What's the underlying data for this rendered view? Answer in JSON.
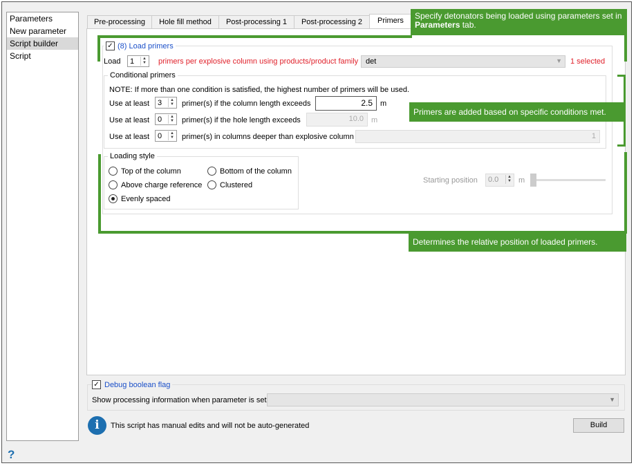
{
  "sidebar": {
    "items": [
      "Parameters",
      "New parameter",
      "Script builder",
      "Script"
    ]
  },
  "tabs": [
    "Pre-processing",
    "Hole fill method",
    "Post-processing 1",
    "Post-processing 2",
    "Primers"
  ],
  "load": {
    "title": "(8) Load primers",
    "label": "Load",
    "count": "1",
    "desc": "primers per explosive column using products/product family",
    "product": "det",
    "selected": "1 selected"
  },
  "conditional": {
    "title": "Conditional primers",
    "note": "NOTE: If more than one condition is satisfied, the highest number of primers will be used.",
    "rows": [
      {
        "label": "Use at least",
        "count": "3",
        "desc": "primer(s) if the column length exceeds",
        "value": "2.5",
        "unit": "m"
      },
      {
        "label": "Use at least",
        "count": "0",
        "desc": "primer(s) if the hole length exceeds",
        "value": "10.0",
        "unit": "m"
      },
      {
        "label": "Use at least",
        "count": "0",
        "desc": "primer(s) in columns deeper than explosive column",
        "value": "1"
      }
    ]
  },
  "loading": {
    "title": "Loading style",
    "options": [
      "Top of the column",
      "Bottom of the column",
      "Above charge reference",
      "Clustered",
      "Evenly spaced"
    ],
    "selected": "Evenly spaced",
    "start_label": "Starting position",
    "start_value": "0.0",
    "start_unit": "m"
  },
  "debug": {
    "title": "Debug boolean flag",
    "label": "Show processing information when parameter is set"
  },
  "info": "This script has manual edits and will not be auto-generated",
  "build": "Build",
  "help": "?",
  "callouts": {
    "top_pre": "Specify detonators being loaded using parameters set in ",
    "top_bold": "Parameters",
    "top_post": " tab.",
    "conditions": "Primers are added based on specific conditions met.",
    "position": "Determines the relative position of loaded primers."
  },
  "colors": {
    "callout": "#4a9a30",
    "red": "#e0202a",
    "link": "#1a4fc8"
  }
}
